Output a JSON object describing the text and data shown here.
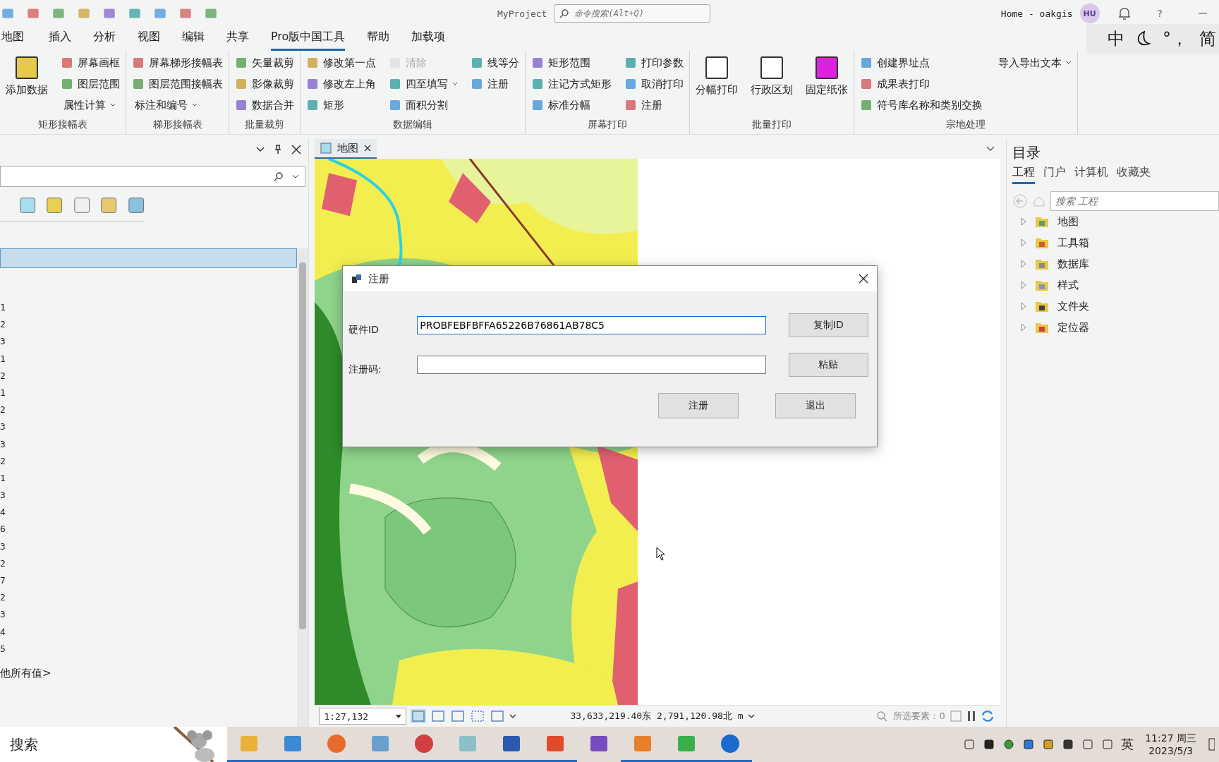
{
  "titlebar": {
    "project": "MyProject",
    "search_placeholder": "命令搜索(Alt+Q)",
    "account": "Home - oakgis",
    "avatar": "HU",
    "help": "?"
  },
  "ime": {
    "mode": "中",
    "punct": "°，",
    "script": "简"
  },
  "menu": [
    {
      "label": "地图",
      "selected": false
    },
    {
      "label": "插入",
      "selected": false
    },
    {
      "label": "分析",
      "selected": false
    },
    {
      "label": "视图",
      "selected": false
    },
    {
      "label": "编辑",
      "selected": false
    },
    {
      "label": "共享",
      "selected": false
    },
    {
      "label": "Pro版中国工具",
      "selected": true
    },
    {
      "label": "帮助",
      "selected": false
    },
    {
      "label": "加载项",
      "selected": false
    }
  ],
  "ribbon": [
    {
      "title": "矩形接幅表",
      "columns": [
        [
          {
            "kind": "large",
            "label": "添加数据"
          }
        ],
        [
          {
            "kind": "small",
            "label": "屏幕画框"
          },
          {
            "kind": "small",
            "label": "图层范围"
          },
          {
            "kind": "dropdown",
            "label": "属性计算"
          }
        ]
      ]
    },
    {
      "title": "梯形接幅表",
      "columns": [
        [
          {
            "kind": "small",
            "label": "屏幕梯形接幅表"
          },
          {
            "kind": "small",
            "label": "图层范围接幅表"
          },
          {
            "kind": "dropdown",
            "label": "标注和编号"
          }
        ]
      ]
    },
    {
      "title": "批量裁剪",
      "columns": [
        [
          {
            "kind": "small",
            "label": "矢量裁剪"
          },
          {
            "kind": "small",
            "label": "影像裁剪"
          },
          {
            "kind": "small",
            "label": "数据合并"
          }
        ]
      ]
    },
    {
      "title": "数据编辑",
      "columns": [
        [
          {
            "kind": "small",
            "label": "修改第一点"
          },
          {
            "kind": "small",
            "label": "修改左上角"
          },
          {
            "kind": "small",
            "label": "矩形"
          }
        ],
        [
          {
            "kind": "small",
            "label": "清除",
            "disabled": true
          },
          {
            "kind": "dropdown-icon",
            "label": "四至填写"
          },
          {
            "kind": "small",
            "label": "面积分割"
          }
        ],
        [
          {
            "kind": "small",
            "label": "线等分"
          },
          {
            "kind": "small",
            "label": "注册"
          }
        ]
      ]
    },
    {
      "title": "屏幕打印",
      "columns": [
        [
          {
            "kind": "small",
            "label": "矩形范围"
          },
          {
            "kind": "small",
            "label": "注记方式矩形"
          },
          {
            "kind": "small",
            "label": "标准分幅"
          }
        ],
        [
          {
            "kind": "small",
            "label": "打印参数"
          },
          {
            "kind": "small",
            "label": "取消打印"
          },
          {
            "kind": "small",
            "label": "注册"
          }
        ]
      ]
    },
    {
      "title": "批量打印",
      "columns": [
        [
          {
            "kind": "large",
            "label": "分幅打印"
          }
        ],
        [
          {
            "kind": "large",
            "label": "行政区划"
          }
        ],
        [
          {
            "kind": "large",
            "label": "固定纸张"
          }
        ]
      ]
    },
    {
      "title": "宗地处理",
      "columns": [
        [
          {
            "kind": "small",
            "label": "创建界址点"
          },
          {
            "kind": "small",
            "label": "成果表打印"
          },
          {
            "kind": "small",
            "label": "符号库名称和类别交换"
          }
        ],
        [
          {
            "kind": "dropdown",
            "label": "导入导出文本"
          }
        ]
      ]
    }
  ],
  "left_pane": {
    "rows": [
      {
        "selected": true
      },
      {
        "label": "1",
        "selected": false
      },
      {
        "label": "2",
        "selected": false
      },
      {
        "label": "3",
        "selected": false
      },
      {
        "label": "1",
        "selected": false
      },
      {
        "label": "2",
        "selected": false
      },
      {
        "label": "1",
        "selected": false
      },
      {
        "label": "2",
        "selected": false
      },
      {
        "label": "3",
        "selected": false
      },
      {
        "label": "3",
        "selected": false
      },
      {
        "label": "2",
        "selected": false
      },
      {
        "label": "1",
        "selected": false
      },
      {
        "label": "3",
        "selected": false
      },
      {
        "label": "4",
        "selected": false
      },
      {
        "label": "6",
        "selected": false
      },
      {
        "label": "3",
        "selected": false
      },
      {
        "label": "2",
        "selected": false
      },
      {
        "label": "7",
        "selected": false
      },
      {
        "label": "2",
        "selected": false
      },
      {
        "label": "3",
        "selected": false
      },
      {
        "label": "4",
        "selected": false
      },
      {
        "label": "5",
        "selected": false
      }
    ],
    "other_values": "他所有值>"
  },
  "map_view": {
    "tab": "地图",
    "scale": "1:27,132",
    "coordinates": "33,633,219.40东 2,791,120.98北 m",
    "selected_features": "所选要素：0"
  },
  "dialog": {
    "title": "注册",
    "fields": [
      {
        "label": "硬件ID",
        "value": "PROBFEBFBFFA65226B76861AB78C5",
        "focused": true,
        "button": "复制ID"
      },
      {
        "label": "注册码:",
        "focused": false,
        "button": "粘贴"
      }
    ],
    "buttons": [
      "注册",
      "退出"
    ]
  },
  "catalog": {
    "title": "目录",
    "tabs": [
      {
        "label": "工程",
        "selected": true
      },
      {
        "label": "门户",
        "selected": false
      },
      {
        "label": "计算机",
        "selected": false
      },
      {
        "label": "收藏夹",
        "selected": false
      }
    ],
    "search_placeholder": "搜索 工程",
    "items": [
      {
        "label": "地图"
      },
      {
        "label": "工具箱"
      },
      {
        "label": "数据库"
      },
      {
        "label": "样式"
      },
      {
        "label": "文件夹"
      },
      {
        "label": "定位器"
      }
    ]
  },
  "taskbar": {
    "search": "搜索",
    "language": "英",
    "time": "11:27 周三",
    "date": "2023/5/3"
  }
}
